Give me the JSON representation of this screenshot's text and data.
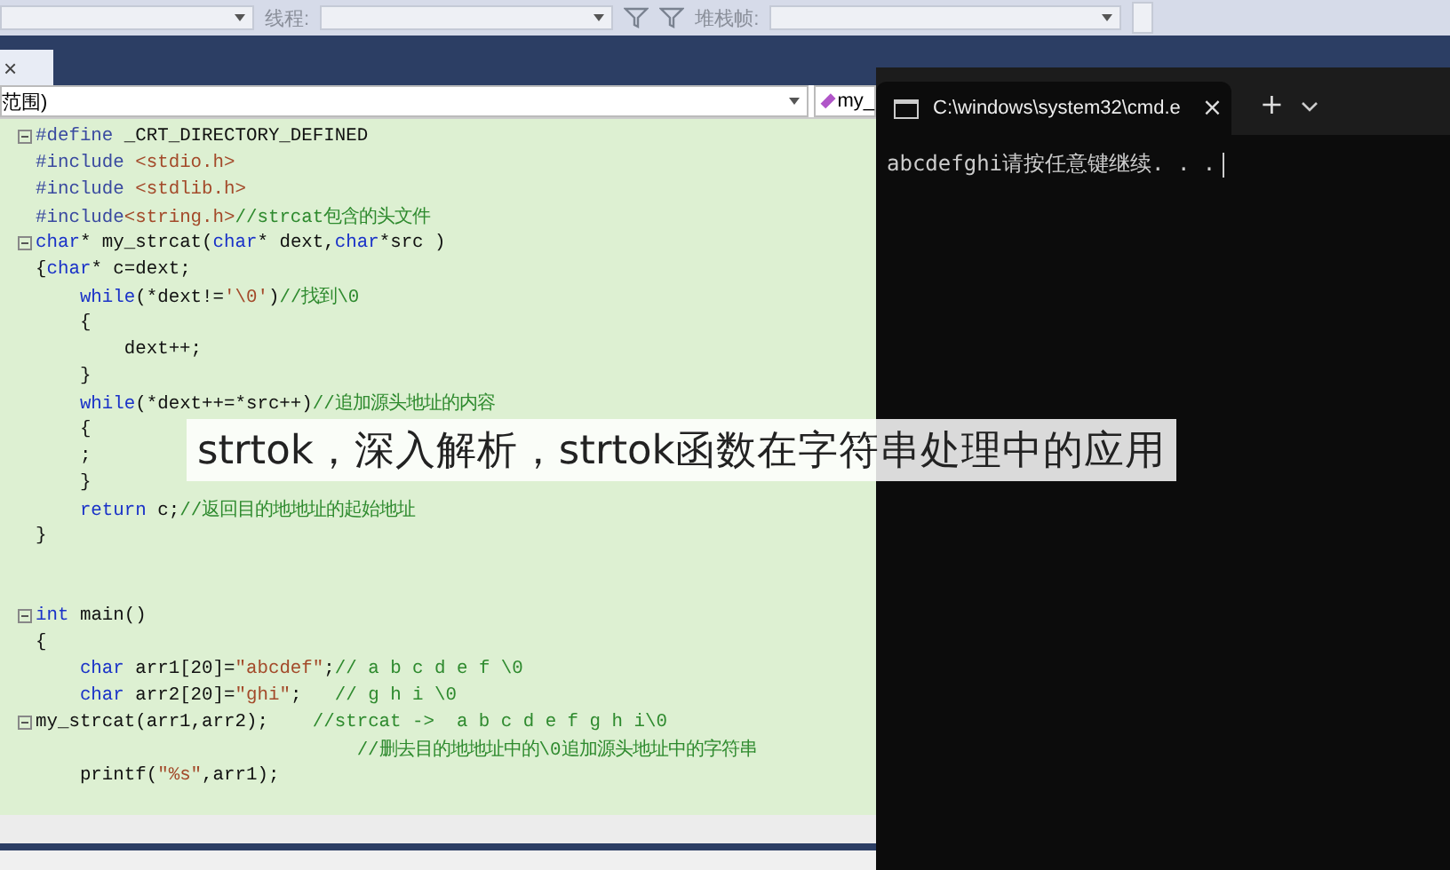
{
  "toolbar": {
    "thread_label": "线程:",
    "stack_frame_label": "堆栈帧:"
  },
  "tab_close": "×",
  "nav": {
    "scope": "范围)",
    "member": "my_"
  },
  "code_lines": [
    {
      "kind": "code",
      "fold": true,
      "segments": [
        {
          "kind": "directive",
          "t": "#define"
        },
        {
          "kind": "plain",
          "t": " _CRT_DIRECTORY_DEFINED"
        }
      ]
    },
    {
      "kind": "code",
      "fold": false,
      "segments": [
        {
          "kind": "directive",
          "t": "#include"
        },
        {
          "kind": "string",
          "t": " <stdio.h>"
        }
      ]
    },
    {
      "kind": "code",
      "fold": false,
      "segments": [
        {
          "kind": "directive",
          "t": "#include"
        },
        {
          "kind": "string",
          "t": " <stdlib.h>"
        }
      ]
    },
    {
      "kind": "code",
      "fold": false,
      "segments": [
        {
          "kind": "directive",
          "t": "#include"
        },
        {
          "kind": "string",
          "t": "<string.h>"
        },
        {
          "kind": "comment",
          "t": "//strcat包含的头文件"
        }
      ]
    },
    {
      "kind": "code",
      "fold": true,
      "segments": [
        {
          "kind": "keyword",
          "t": "char"
        },
        {
          "kind": "plain",
          "t": "* my_strcat("
        },
        {
          "kind": "keyword",
          "t": "char"
        },
        {
          "kind": "plain",
          "t": "* dext,"
        },
        {
          "kind": "keyword",
          "t": "char"
        },
        {
          "kind": "plain",
          "t": "*src )"
        }
      ]
    },
    {
      "kind": "code",
      "fold": false,
      "segments": [
        {
          "kind": "plain",
          "t": "{"
        },
        {
          "kind": "keyword",
          "t": "char"
        },
        {
          "kind": "plain",
          "t": "* c=dext;"
        }
      ]
    },
    {
      "kind": "code",
      "fold": false,
      "segments": [
        {
          "kind": "keyword",
          "t": "    while"
        },
        {
          "kind": "plain",
          "t": "(*dext!="
        },
        {
          "kind": "string",
          "t": "'\\0'"
        },
        {
          "kind": "plain",
          "t": ")"
        },
        {
          "kind": "comment",
          "t": "//找到\\0"
        }
      ]
    },
    {
      "kind": "code",
      "fold": false,
      "segments": [
        {
          "kind": "plain",
          "t": "    {"
        }
      ]
    },
    {
      "kind": "code",
      "fold": false,
      "segments": [
        {
          "kind": "plain",
          "t": "        dext++;"
        }
      ]
    },
    {
      "kind": "code",
      "fold": false,
      "segments": [
        {
          "kind": "plain",
          "t": "    }"
        }
      ]
    },
    {
      "kind": "code",
      "fold": false,
      "segments": [
        {
          "kind": "keyword",
          "t": "    while"
        },
        {
          "kind": "plain",
          "t": "(*dext++=*src++)"
        },
        {
          "kind": "comment",
          "t": "//追加源头地址的内容"
        }
      ]
    },
    {
      "kind": "code",
      "fold": false,
      "segments": [
        {
          "kind": "plain",
          "t": "    {"
        }
      ]
    },
    {
      "kind": "code",
      "fold": false,
      "segments": [
        {
          "kind": "plain",
          "t": "    ;"
        }
      ]
    },
    {
      "kind": "code",
      "fold": false,
      "segments": [
        {
          "kind": "plain",
          "t": "    }"
        }
      ]
    },
    {
      "kind": "code",
      "fold": false,
      "segments": [
        {
          "kind": "keyword",
          "t": "    return"
        },
        {
          "kind": "plain",
          "t": " c;"
        },
        {
          "kind": "comment",
          "t": "//返回目的地地址的起始地址"
        }
      ]
    },
    {
      "kind": "code",
      "fold": false,
      "segments": [
        {
          "kind": "plain",
          "t": "}"
        }
      ]
    },
    {
      "kind": "blank"
    },
    {
      "kind": "blank"
    },
    {
      "kind": "code",
      "fold": true,
      "segments": [
        {
          "kind": "keyword",
          "t": "int"
        },
        {
          "kind": "plain",
          "t": " main()"
        }
      ]
    },
    {
      "kind": "code",
      "fold": false,
      "segments": [
        {
          "kind": "plain",
          "t": "{"
        }
      ]
    },
    {
      "kind": "code",
      "fold": false,
      "segments": [
        {
          "kind": "keyword",
          "t": "    char"
        },
        {
          "kind": "plain",
          "t": " arr1[20]="
        },
        {
          "kind": "string",
          "t": "\"abcdef\""
        },
        {
          "kind": "plain",
          "t": ";"
        },
        {
          "kind": "comment",
          "t": "// a b c d e f \\0"
        }
      ]
    },
    {
      "kind": "code",
      "fold": false,
      "segments": [
        {
          "kind": "keyword",
          "t": "    char"
        },
        {
          "kind": "plain",
          "t": " arr2[20]="
        },
        {
          "kind": "string",
          "t": "\"ghi\""
        },
        {
          "kind": "plain",
          "t": ";   "
        },
        {
          "kind": "comment",
          "t": "// g h i \\0"
        }
      ]
    },
    {
      "kind": "code",
      "fold": true,
      "segments": [
        {
          "kind": "plain",
          "t": "my_strcat(arr1,arr2);    "
        },
        {
          "kind": "comment",
          "t": "//strcat ->  a b c d e f g h i\\0"
        }
      ]
    },
    {
      "kind": "code",
      "fold": false,
      "segments": [
        {
          "kind": "comment",
          "t": "                             //删去目的地地址中的\\0追加源头地址中的字符串"
        }
      ]
    },
    {
      "kind": "code",
      "fold": false,
      "segments": [
        {
          "kind": "plain",
          "t": "    printf("
        },
        {
          "kind": "string",
          "t": "\"%s\""
        },
        {
          "kind": "plain",
          "t": ",arr1);"
        }
      ]
    }
  ],
  "console": {
    "tab_title": "C:\\windows\\system32\\cmd.e",
    "tab_close": "×",
    "new_tab": "+",
    "output": "abcdefghi请按任意键继续. . ."
  },
  "caption": "strtok，深入解析，strtok函数在字符串处理中的应用"
}
